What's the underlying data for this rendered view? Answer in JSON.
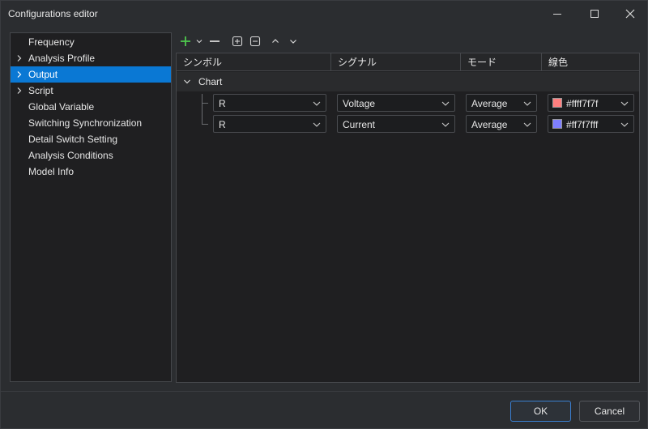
{
  "window": {
    "title": "Configurations editor"
  },
  "sidebar": {
    "items": [
      {
        "label": "Frequency",
        "expandable": false,
        "selected": false
      },
      {
        "label": "Analysis Profile",
        "expandable": true,
        "selected": false
      },
      {
        "label": "Output",
        "expandable": true,
        "selected": true
      },
      {
        "label": "Script",
        "expandable": true,
        "selected": false
      },
      {
        "label": "Global Variable",
        "expandable": false,
        "selected": false
      },
      {
        "label": "Switching Synchronization",
        "expandable": false,
        "selected": false
      },
      {
        "label": "Detail Switch Setting",
        "expandable": false,
        "selected": false
      },
      {
        "label": "Analysis Conditions",
        "expandable": false,
        "selected": false
      },
      {
        "label": "Model Info",
        "expandable": false,
        "selected": false
      }
    ]
  },
  "toolbar": {
    "icons": [
      "add-icon",
      "dropdown-chevron-icon",
      "remove-icon",
      "expand-all-icon",
      "collapse-all-icon",
      "move-up-icon",
      "move-down-icon"
    ]
  },
  "grid": {
    "columns": [
      "シンボル",
      "シグナル",
      "モード",
      "線色"
    ],
    "group": {
      "label": "Chart",
      "expanded": true
    },
    "rows": [
      {
        "symbol": "R",
        "signal": "Voltage",
        "mode": "Average",
        "color_label": "#ffff7f7f",
        "swatch": "#ff7f7f"
      },
      {
        "symbol": "R",
        "signal": "Current",
        "mode": "Average",
        "color_label": "#ff7f7fff",
        "swatch": "#7f7fff"
      }
    ]
  },
  "footer": {
    "ok_label": "OK",
    "cancel_label": "Cancel"
  },
  "colors": {
    "accent": "#0a78d4",
    "background": "#2b2d30",
    "panel": "#1f1f21",
    "add_green": "#4ec94e"
  }
}
